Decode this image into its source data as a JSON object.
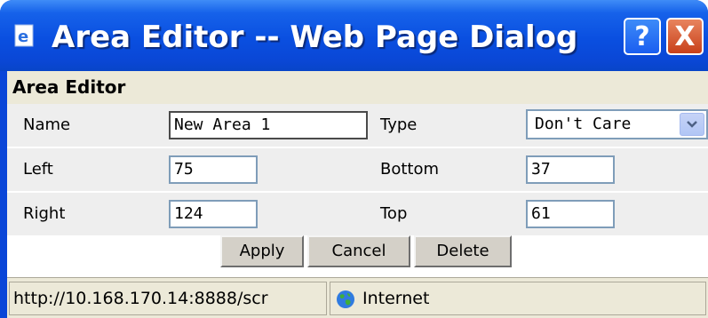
{
  "window": {
    "title": "Area Editor -- Web Page Dialog",
    "help_label": "?",
    "close_label": "X",
    "titlebar_color": "#0a4fe0",
    "close_color": "#d4542b"
  },
  "panel": {
    "header": "Area Editor"
  },
  "fields": {
    "name_label": "Name",
    "name_value": "New Area 1",
    "type_label": "Type",
    "type_value": "Don't Care",
    "left_label": "Left",
    "left_value": "75",
    "bottom_label": "Bottom",
    "bottom_value": "37",
    "right_label": "Right",
    "right_value": "124",
    "top_label": "Top",
    "top_value": "61"
  },
  "buttons": {
    "apply": "Apply",
    "cancel": "Cancel",
    "delete": "Delete"
  },
  "status": {
    "url": "http://10.168.170.14:8888/scr",
    "zone": "Internet",
    "zone_icon": "globe-icon"
  }
}
